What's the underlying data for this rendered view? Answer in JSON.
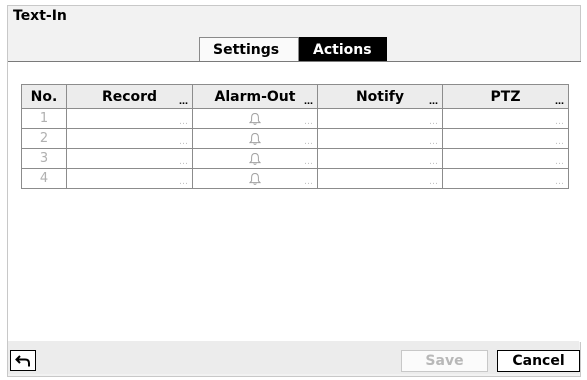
{
  "window": {
    "title": "Text-In"
  },
  "tabs": [
    {
      "label": "Settings",
      "active": false
    },
    {
      "label": "Actions",
      "active": true
    }
  ],
  "table": {
    "columns": [
      "No.",
      "Record",
      "Alarm-Out",
      "Notify",
      "PTZ"
    ],
    "rows": [
      {
        "no": "1",
        "record": "",
        "alarm_out_icon": "bell-icon",
        "notify": "",
        "ptz": ""
      },
      {
        "no": "2",
        "record": "",
        "alarm_out_icon": "bell-icon",
        "notify": "",
        "ptz": ""
      },
      {
        "no": "3",
        "record": "",
        "alarm_out_icon": "bell-icon",
        "notify": "",
        "ptz": ""
      },
      {
        "no": "4",
        "record": "",
        "alarm_out_icon": "bell-icon",
        "notify": "",
        "ptz": ""
      }
    ],
    "ellipsis": "…"
  },
  "footer": {
    "back_icon": "return-arrow-icon",
    "save_label": "Save",
    "cancel_label": "Cancel"
  },
  "colors": {
    "active_tab": "#000000",
    "disabled_text": "#b8b8b8"
  }
}
